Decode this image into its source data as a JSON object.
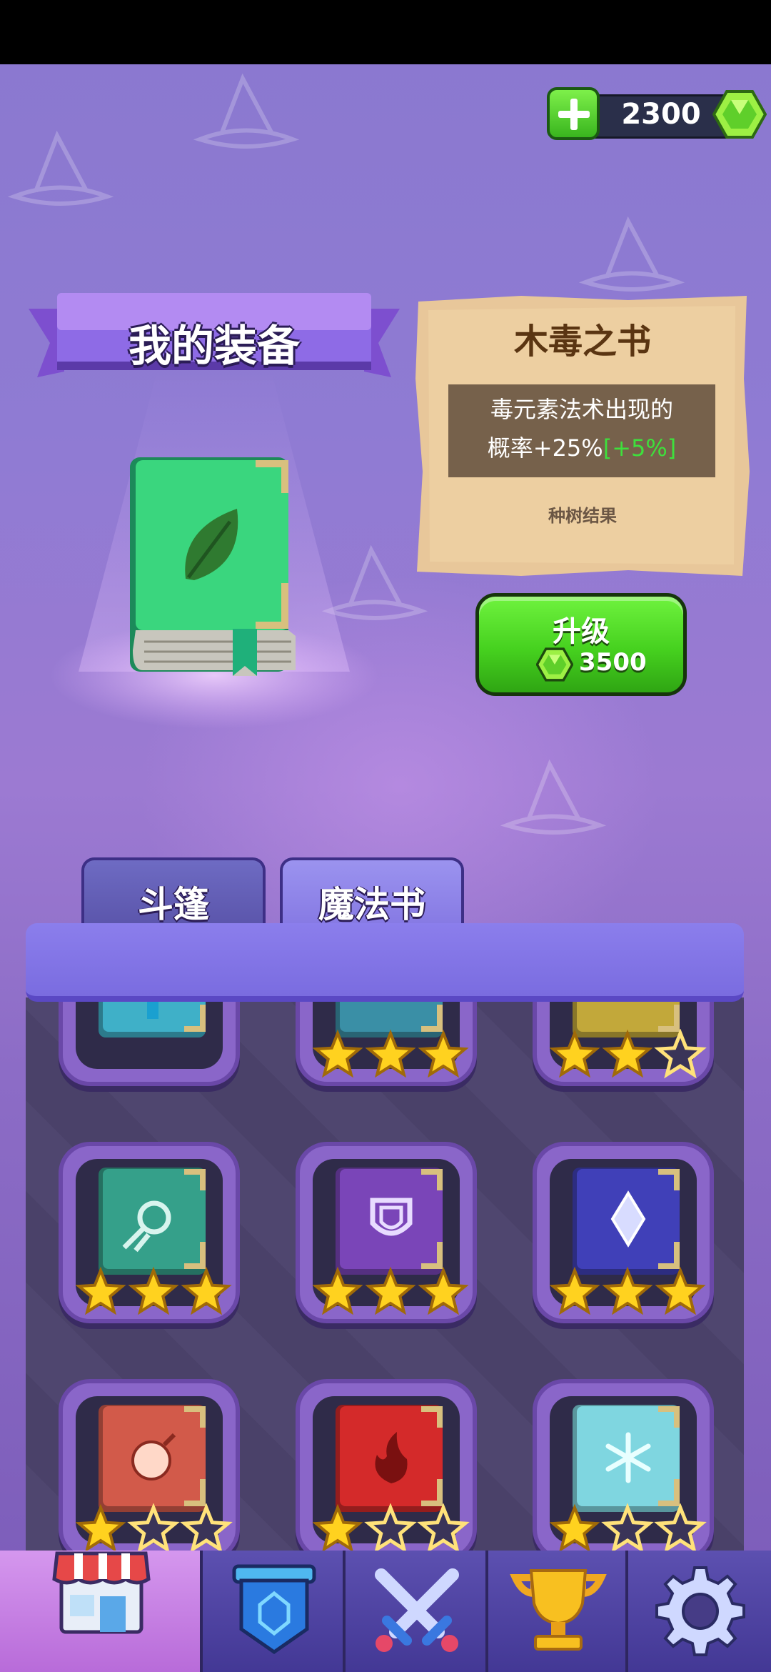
{
  "currency": {
    "amount": "2300",
    "gem_icon": "green-gem-icon",
    "add_icon": "plus-icon"
  },
  "banner": {
    "title": "我的装备"
  },
  "item": {
    "name": "木毒之书",
    "description_line1": "毒元素法术出现的",
    "description_line2": "概率+25%",
    "bonus": "[+5%]",
    "source": "种树结果",
    "icon": "leaf-icon"
  },
  "upgrade": {
    "label": "升级",
    "cost": "3500"
  },
  "tabs": [
    {
      "label": "斗篷",
      "selected": false
    },
    {
      "label": "魔法书",
      "selected": true
    }
  ],
  "books": [
    {
      "color": "#3fb0c8",
      "emblem": "bookmark",
      "stars": 0
    },
    {
      "color": "#3a8fa6",
      "emblem": "claw",
      "stars": 3
    },
    {
      "color": "#c2a83a",
      "emblem": "swirl",
      "stars": 2
    },
    {
      "color": "#35a08a",
      "emblem": "comet",
      "stars": 3
    },
    {
      "color": "#7a45b8",
      "emblem": "shield",
      "stars": 3
    },
    {
      "color": "#4040b8",
      "emblem": "diamond",
      "stars": 3
    },
    {
      "color": "#d25a4a",
      "emblem": "bomb",
      "stars": 1
    },
    {
      "color": "#d42a2a",
      "emblem": "fire",
      "stars": 1
    },
    {
      "color": "#7fd6e0",
      "emblem": "snowflake",
      "stars": 1
    }
  ],
  "nav": [
    {
      "name": "shop",
      "icon": "shop-icon",
      "active": true
    },
    {
      "name": "badge",
      "icon": "shield-badge-icon",
      "active": false
    },
    {
      "name": "battle",
      "icon": "crossed-swords-icon",
      "active": false
    },
    {
      "name": "trophy",
      "icon": "trophy-icon",
      "active": false
    },
    {
      "name": "settings",
      "icon": "gear-icon",
      "active": false
    }
  ]
}
